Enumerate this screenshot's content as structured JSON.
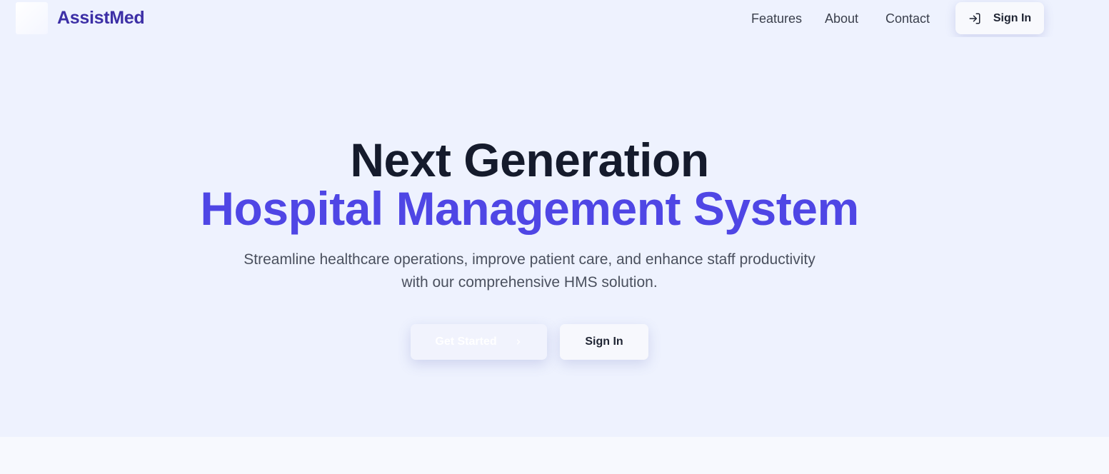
{
  "brand": {
    "name": "AssistMed"
  },
  "nav": {
    "links": [
      {
        "label": "Features"
      },
      {
        "label": "About"
      },
      {
        "label": "Contact"
      }
    ],
    "signin_label": "Sign In",
    "signin_icon": "sign-in-icon"
  },
  "hero": {
    "title_line1": "Next Generation",
    "title_line2": "Hospital Management System",
    "subtitle_line1": "Streamline healthcare operations, improve patient care, and enhance staff productivity",
    "subtitle_line2": "with our comprehensive HMS solution.",
    "primary_cta": "Get Started",
    "primary_cta_icon": "chevron-right-icon",
    "secondary_cta": "Sign In"
  },
  "colors": {
    "accent": "#4f46e5",
    "brand": "#3c2fa6",
    "heading": "#151b2c",
    "background": "#eef2fe"
  }
}
